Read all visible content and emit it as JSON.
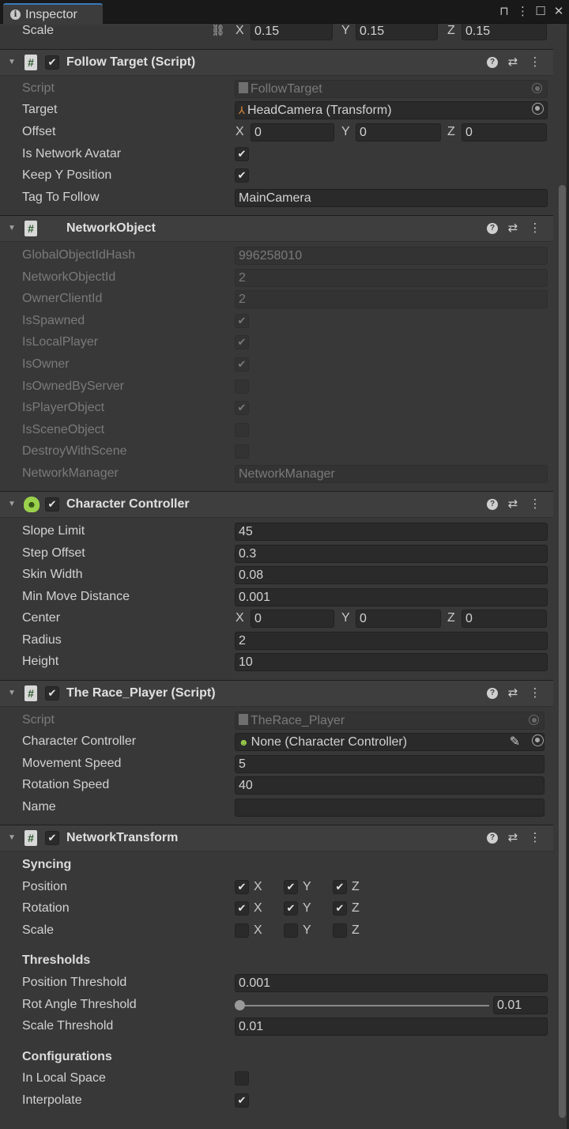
{
  "window": {
    "tab_title": "Inspector",
    "icons": [
      "lock-icon",
      "kebab-menu-icon",
      "maximize-icon",
      "close-icon"
    ]
  },
  "scale_row": {
    "label": "Scale",
    "x": "0.15",
    "y": "0.15",
    "z": "0.15"
  },
  "axis": {
    "x": "X",
    "y": "Y",
    "z": "Z"
  },
  "follow_target": {
    "title": "Follow Target (Script)",
    "script_label": "Script",
    "script_value": "FollowTarget",
    "target_label": "Target",
    "target_value": "HeadCamera (Transform)",
    "offset_label": "Offset",
    "offset_x": "0",
    "offset_y": "0",
    "offset_z": "0",
    "is_network_avatar_label": "Is Network Avatar",
    "is_network_avatar": true,
    "keep_y_label": "Keep Y Position",
    "keep_y": true,
    "tag_label": "Tag To Follow",
    "tag_value": "MainCamera"
  },
  "network_object": {
    "title": "NetworkObject",
    "hash_label": "GlobalObjectIdHash",
    "hash_value": "996258010",
    "objid_label": "NetworkObjectId",
    "objid_value": "2",
    "owner_label": "OwnerClientId",
    "owner_value": "2",
    "flags": [
      {
        "label": "IsSpawned",
        "checked": true
      },
      {
        "label": "IsLocalPlayer",
        "checked": true
      },
      {
        "label": "IsOwner",
        "checked": true
      },
      {
        "label": "IsOwnedByServer",
        "checked": false
      },
      {
        "label": "IsPlayerObject",
        "checked": true
      },
      {
        "label": "IsSceneObject",
        "checked": false
      },
      {
        "label": "DestroyWithScene",
        "checked": false
      }
    ],
    "manager_label": "NetworkManager",
    "manager_value": "NetworkManager"
  },
  "character_controller": {
    "title": "Character Controller",
    "slope_label": "Slope Limit",
    "slope_value": "45",
    "step_label": "Step Offset",
    "step_value": "0.3",
    "skin_label": "Skin Width",
    "skin_value": "0.08",
    "minmove_label": "Min Move Distance",
    "minmove_value": "0.001",
    "center_label": "Center",
    "center_x": "0",
    "center_y": "0",
    "center_z": "0",
    "radius_label": "Radius",
    "radius_value": "2",
    "height_label": "Height",
    "height_value": "10"
  },
  "race_player": {
    "title": "The Race_Player (Script)",
    "script_label": "Script",
    "script_value": "TheRace_Player",
    "cc_label": "Character Controller",
    "cc_value": "None (Character Controller)",
    "move_label": "Movement Speed",
    "move_value": "5",
    "rot_label": "Rotation Speed",
    "rot_value": "40",
    "name_label": "Name",
    "name_value": ""
  },
  "network_transform": {
    "title": "NetworkTransform",
    "syncing_label": "Syncing",
    "position_label": "Position",
    "position": [
      true,
      true,
      true
    ],
    "rotation_label": "Rotation",
    "rotation": [
      true,
      true,
      true
    ],
    "scale_label": "Scale",
    "scale": [
      false,
      false,
      false
    ],
    "thresholds_label": "Thresholds",
    "pos_thr_label": "Position Threshold",
    "pos_thr_value": "0.001",
    "rot_thr_label": "Rot Angle Threshold",
    "rot_thr_value": "0.01",
    "scale_thr_label": "Scale Threshold",
    "scale_thr_value": "0.01",
    "config_label": "Configurations",
    "local_space_label": "In Local Space",
    "local_space": false,
    "interpolate_label": "Interpolate",
    "interpolate": true
  }
}
